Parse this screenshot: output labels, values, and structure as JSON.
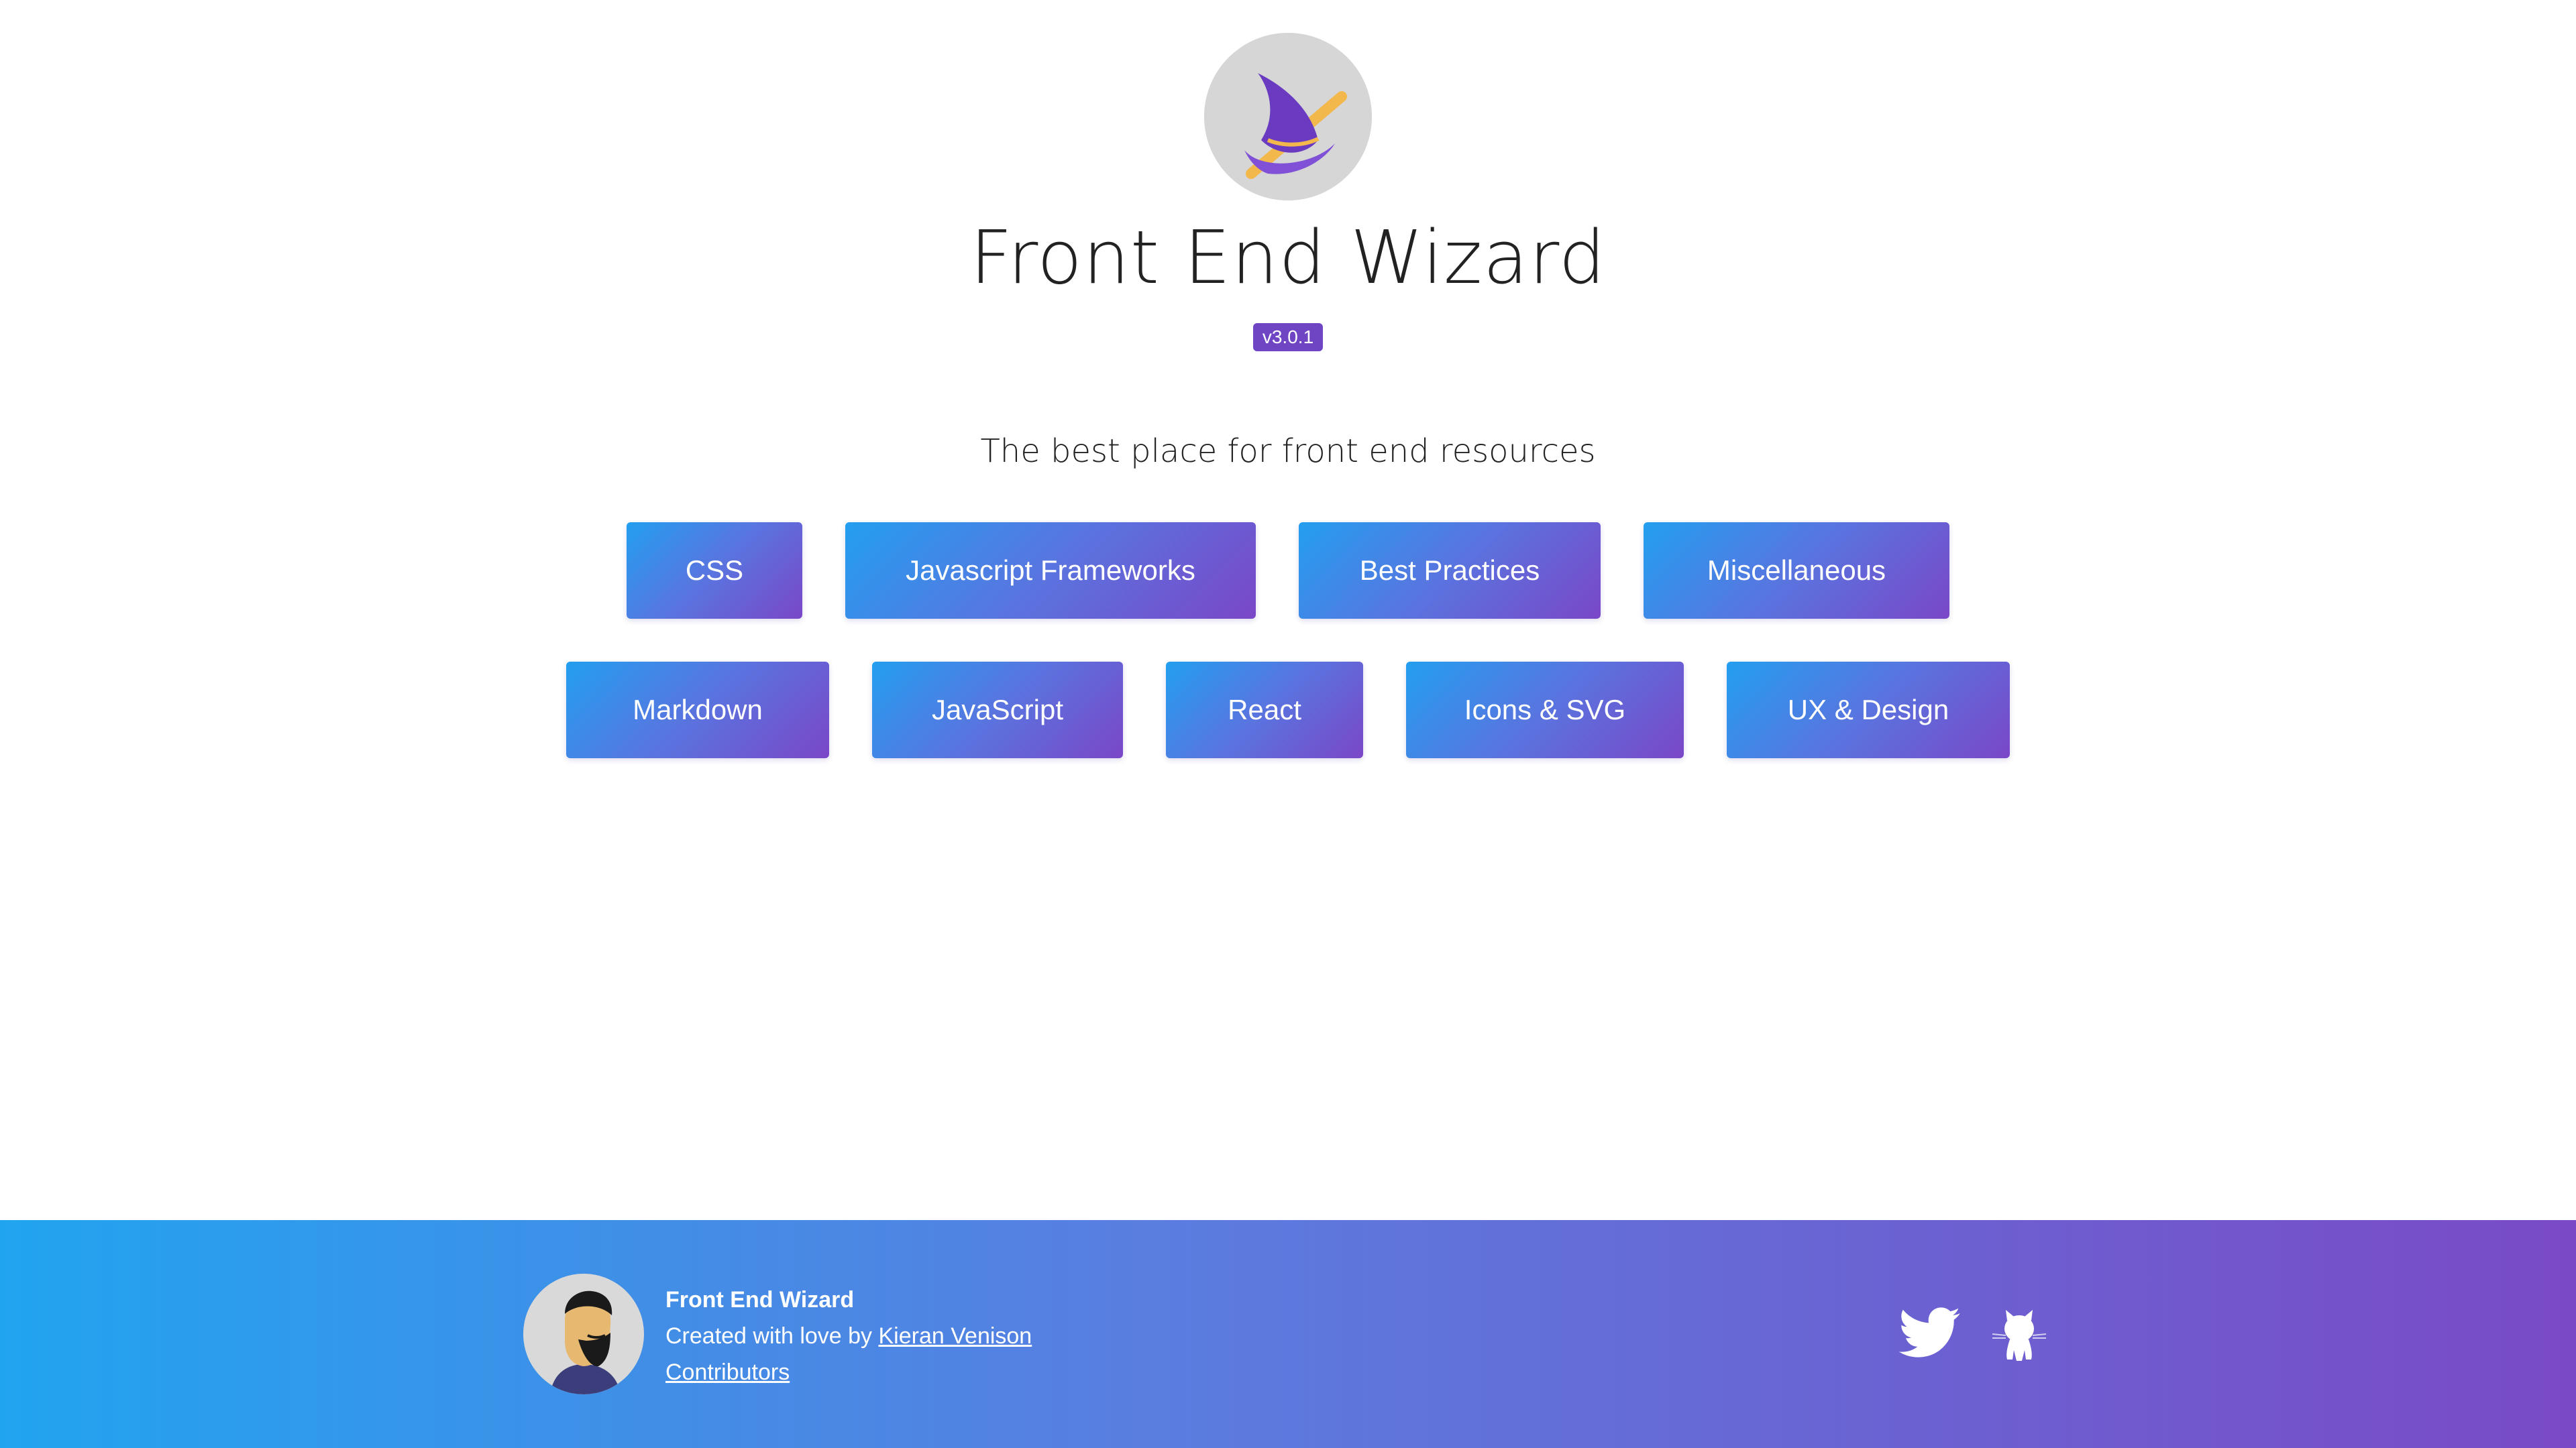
{
  "header": {
    "title": "Front End Wizard",
    "version": "v3.0.1",
    "tagline": "The best place for front end resources",
    "logo_icon": "wizard-hat-icon"
  },
  "categories": {
    "row1": [
      "CSS",
      "Javascript Frameworks",
      "Best Practices",
      "Miscellaneous"
    ],
    "row2": [
      "Markdown",
      "JavaScript",
      "React",
      "Icons & SVG",
      "UX & Design"
    ]
  },
  "footer": {
    "brand": "Front End Wizard",
    "created_prefix": "Created with love by",
    "author_link": "Kieran Venison",
    "contributors_link": "Contributors",
    "social": [
      "twitter-icon",
      "github-icon"
    ]
  },
  "colors": {
    "accent_start": "#239ff0",
    "accent_end": "#7a47c8",
    "version_badge": "#6f45c4"
  }
}
